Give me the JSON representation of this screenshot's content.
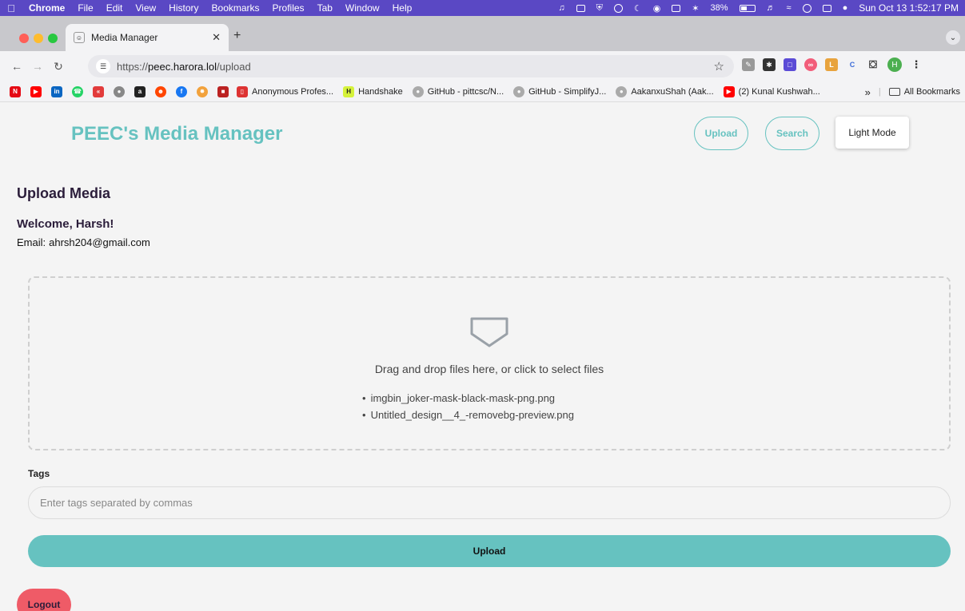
{
  "menubar": {
    "app": "Chrome",
    "items": [
      "File",
      "Edit",
      "View",
      "History",
      "Bookmarks",
      "Profiles",
      "Tab",
      "Window",
      "Help"
    ],
    "battery": "38%",
    "clock": "Sun Oct 13  1:52:17 PM"
  },
  "browser": {
    "tab_title": "Media Manager",
    "url_prefix": "https://",
    "url_host": "peec.harora.lol",
    "url_path": "/upload",
    "profile_initial": "H",
    "bookmarks": [
      "Anonymous Profes...",
      "Handshake",
      "GitHub - pittcsc/N...",
      "GitHub - SimplifyJ...",
      "AakanxuShah (Aak...",
      "(2) Kunal Kushwah..."
    ],
    "all_bookmarks": "All Bookmarks",
    "overflow": "»"
  },
  "header": {
    "brand": "PEEC's Media Manager",
    "nav_upload": "Upload",
    "nav_search": "Search",
    "mode_toggle": "Light Mode"
  },
  "main": {
    "title": "Upload Media",
    "welcome": "Welcome, Harsh!",
    "email_label": "Email:",
    "email": "ahrsh204@gmail.com",
    "dropzone_text": "Drag and drop files here, or click to select files",
    "files": [
      "imgbin_joker-mask-black-mask-png.png",
      "Untitled_design__4_-removebg-preview.png"
    ],
    "tags_label": "Tags",
    "tags_placeholder": "Enter tags separated by commas",
    "upload_button": "Upload",
    "logout_button": "Logout"
  },
  "colors": {
    "accent": "#66c2c0",
    "logout": "#ef5b67",
    "menubar": "#5a48c4"
  }
}
